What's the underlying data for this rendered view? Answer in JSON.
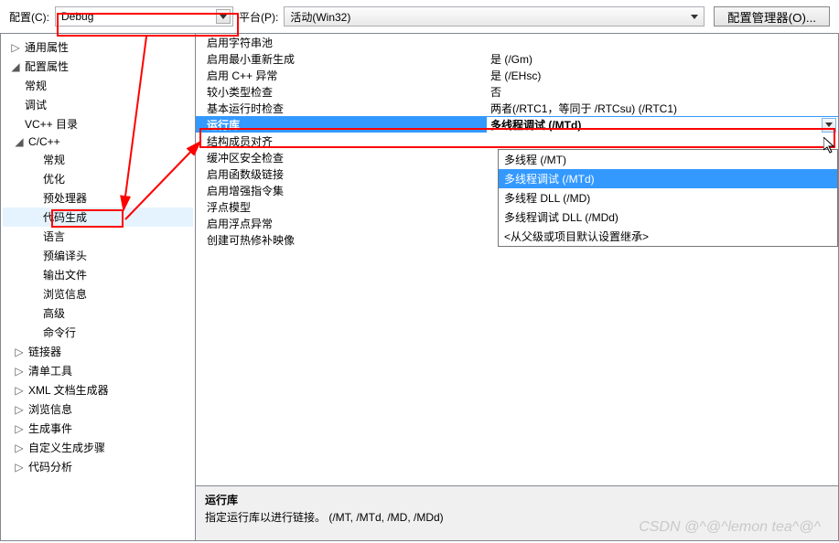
{
  "topbar": {
    "config_label": "配置(C):",
    "config_value": "Debug",
    "platform_label": "平台(P):",
    "platform_value": "活动(Win32)",
    "cfg_manager": "配置管理器(O)..."
  },
  "tree": {
    "n0": "通用属性",
    "n1": "配置属性",
    "n1_0": "常规",
    "n1_1": "调试",
    "n1_2": "VC++ 目录",
    "n1_3": "C/C++",
    "n1_3_0": "常规",
    "n1_3_1": "优化",
    "n1_3_2": "预处理器",
    "n1_3_3": "代码生成",
    "n1_3_4": "语言",
    "n1_3_5": "预编译头",
    "n1_3_6": "输出文件",
    "n1_3_7": "浏览信息",
    "n1_3_8": "高级",
    "n1_3_9": "命令行",
    "n1_4": "链接器",
    "n1_5": "清单工具",
    "n1_6": "XML 文档生成器",
    "n1_7": "浏览信息",
    "n1_8": "生成事件",
    "n1_9": "自定义生成步骤",
    "n1_10": "代码分析"
  },
  "props": {
    "r0k": "启用字符串池",
    "r0v": "",
    "r1k": "启用最小重新生成",
    "r1v": "是 (/Gm)",
    "r2k": "启用 C++ 异常",
    "r2v": "是 (/EHsc)",
    "r3k": "较小类型检查",
    "r3v": "否",
    "r4k": "基本运行时检查",
    "r4v": "两者(/RTC1，等同于 /RTCsu) (/RTC1)",
    "r5k": "运行库",
    "r5v": "多线程调试 (/MTd)",
    "r6k": "结构成员对齐",
    "r6v": "",
    "r7k": "缓冲区安全检查",
    "r7v": "",
    "r8k": "启用函数级链接",
    "r8v": "",
    "r9k": "启用增强指令集",
    "r9v": "",
    "r10k": "浮点模型",
    "r10v": "",
    "r11k": "启用浮点异常",
    "r11v": "",
    "r12k": "创建可热修补映像",
    "r12v": ""
  },
  "dropdown": {
    "o0": "多线程 (/MT)",
    "o1": "多线程调试 (/MTd)",
    "o2": "多线程 DLL (/MD)",
    "o3": "多线程调试 DLL (/MDd)",
    "o4": "<从父级或项目默认设置继承>"
  },
  "desc": {
    "title": "运行库",
    "body": "指定运行库以进行链接。     (/MT, /MTd, /MD, /MDd)"
  },
  "watermark": "CSDN @^@^lemon tea^@^"
}
